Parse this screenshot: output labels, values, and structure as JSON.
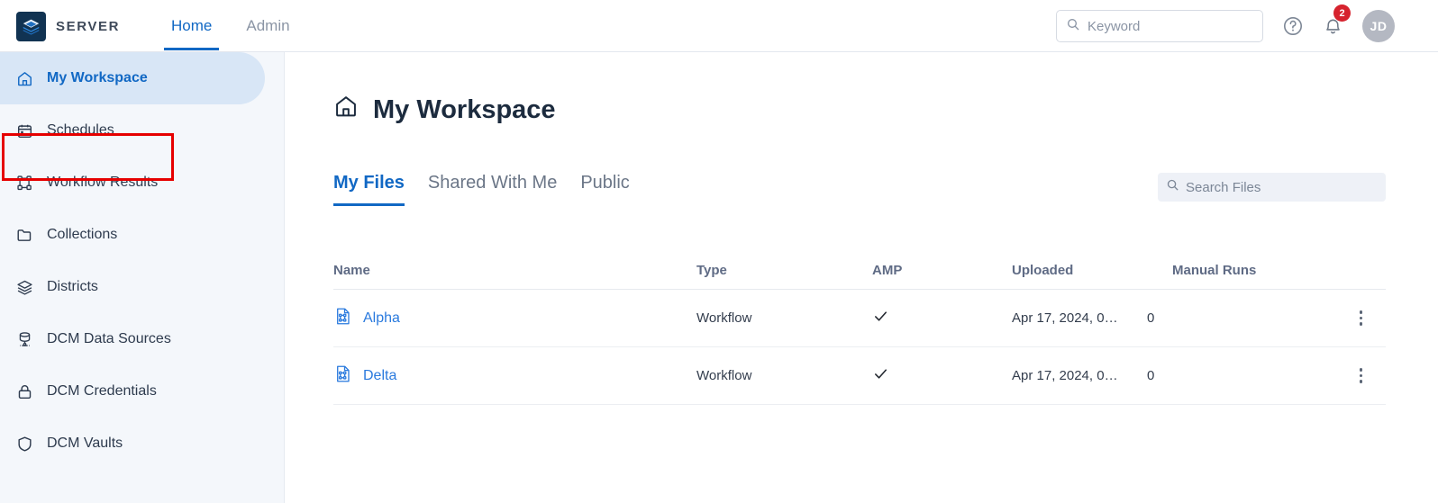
{
  "header": {
    "brand": "SERVER",
    "logo_icon": "layers-logo-icon",
    "nav": [
      {
        "label": "Home",
        "active": true
      },
      {
        "label": "Admin",
        "active": false
      }
    ],
    "search": {
      "placeholder": "Keyword",
      "value": "",
      "icon": "search-icon"
    },
    "help_icon": "help-circle-icon",
    "bell_icon": "bell-icon",
    "notification_count": "2",
    "avatar_initials": "JD",
    "accent_color": "#1168c4",
    "badge_color": "#d6232e"
  },
  "sidebar": {
    "items": [
      {
        "label": "My Workspace",
        "icon": "home-icon",
        "active": true
      },
      {
        "label": "Schedules",
        "icon": "calendar-icon",
        "active": false
      },
      {
        "label": "Workflow Results",
        "icon": "workflow-icon",
        "active": false
      },
      {
        "label": "Collections",
        "icon": "folder-icon",
        "active": false
      },
      {
        "label": "Districts",
        "icon": "layers-icon",
        "active": false
      },
      {
        "label": "DCM Data Sources",
        "icon": "database-icon",
        "active": false
      },
      {
        "label": "DCM Credentials",
        "icon": "lock-icon",
        "active": false
      },
      {
        "label": "DCM Vaults",
        "icon": "shield-icon",
        "active": false
      }
    ],
    "highlight_color": "#e60000"
  },
  "main": {
    "title": "My Workspace",
    "title_icon": "home-icon",
    "tabs": [
      {
        "label": "My Files",
        "active": true
      },
      {
        "label": "Shared With Me",
        "active": false
      },
      {
        "label": "Public",
        "active": false
      }
    ],
    "file_search": {
      "placeholder": "Search Files",
      "value": "",
      "icon": "search-icon"
    },
    "table": {
      "columns": [
        "Name",
        "Type",
        "AMP",
        "Uploaded",
        "Manual Runs"
      ],
      "rows": [
        {
          "name": "Alpha",
          "icon": "workflow-file-icon",
          "type": "Workflow",
          "amp": "✓",
          "uploaded": "Apr 17, 2024, 0…",
          "manual_runs": "0",
          "actions_icon": "kebab-menu-icon"
        },
        {
          "name": "Delta",
          "icon": "workflow-file-icon",
          "type": "Workflow",
          "amp": "✓",
          "uploaded": "Apr 17, 2024, 0…",
          "manual_runs": "0",
          "actions_icon": "kebab-menu-icon"
        }
      ]
    }
  }
}
